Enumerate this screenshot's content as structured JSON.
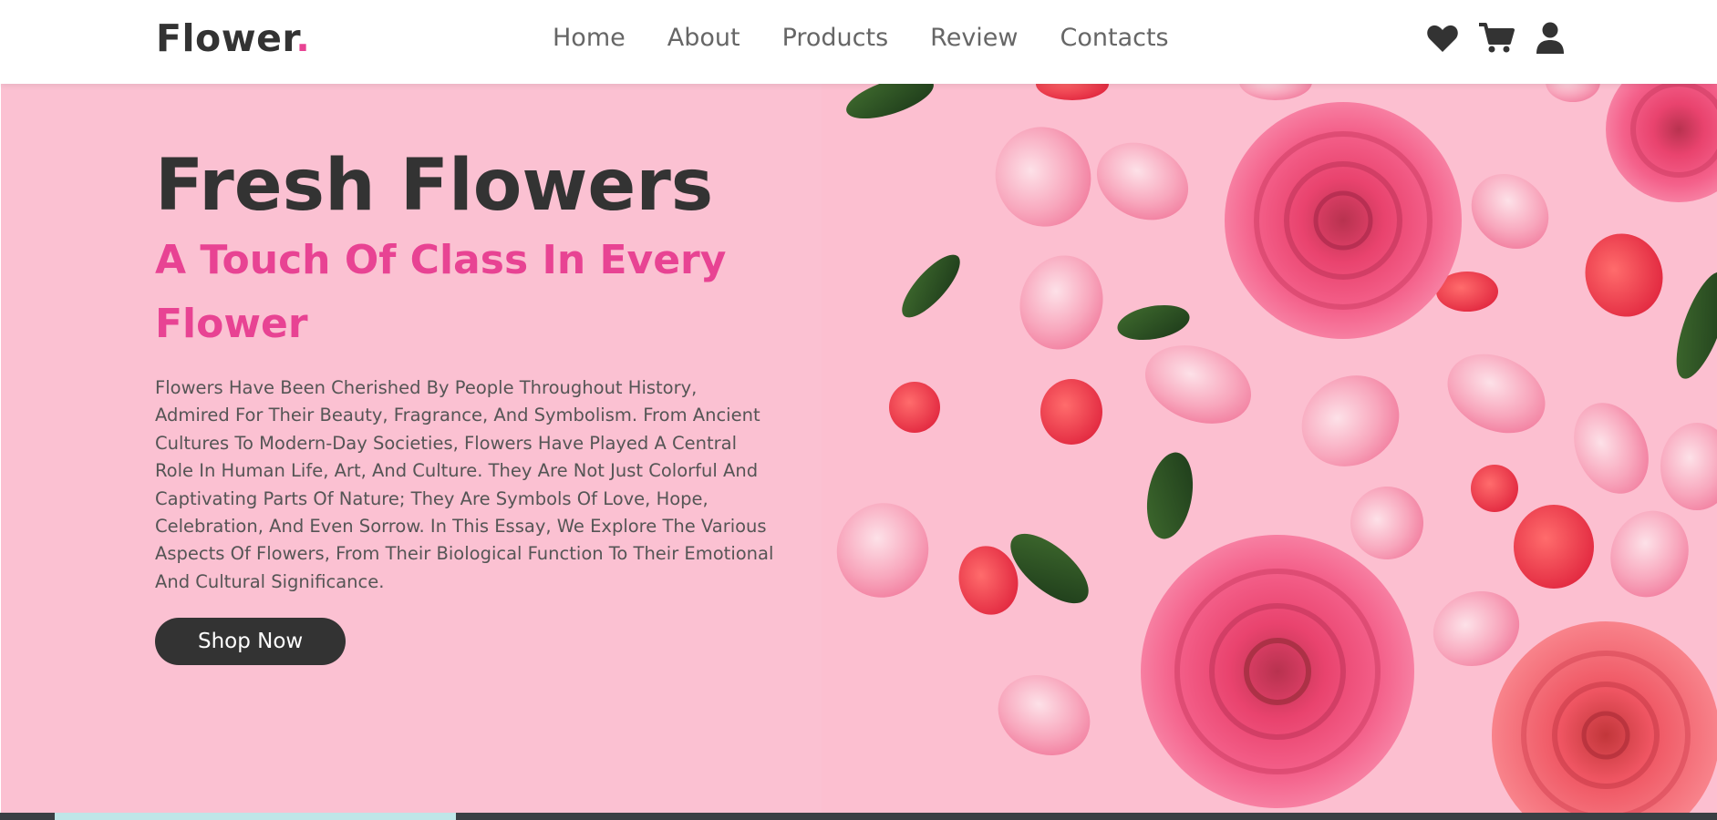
{
  "brand": {
    "name": "Flower",
    "dot": ".",
    "accent_color": "#e84393"
  },
  "nav": {
    "items": [
      {
        "label": "Home"
      },
      {
        "label": "About"
      },
      {
        "label": "Products"
      },
      {
        "label": "Review"
      },
      {
        "label": "Contacts"
      }
    ]
  },
  "header_icons": [
    "heart-icon",
    "cart-icon",
    "user-icon"
  ],
  "hero": {
    "title": "Fresh Flowers",
    "subtitle": "A Touch Of Class In Every Flower",
    "description": "Flowers Have Been Cherished By People Throughout History, Admired For Their Beauty, Fragrance, And Symbolism. From Ancient Cultures To Modern-Day Societies, Flowers Have Played A Central Role In Human Life, Art, And Culture. They Are Not Just Colorful And Captivating Parts Of Nature; They Are Symbols Of Love, Hope, Celebration, And Even Sorrow. In This Essay, We Explore The Various Aspects Of Flowers, From Their Biological Function To Their Emotional And Cultural Significance.",
    "button_label": "Shop Now",
    "background_color": "#fbc1d2"
  },
  "colors": {
    "text_dark": "#333333",
    "text_muted": "#666666",
    "accent": "#e84393"
  }
}
